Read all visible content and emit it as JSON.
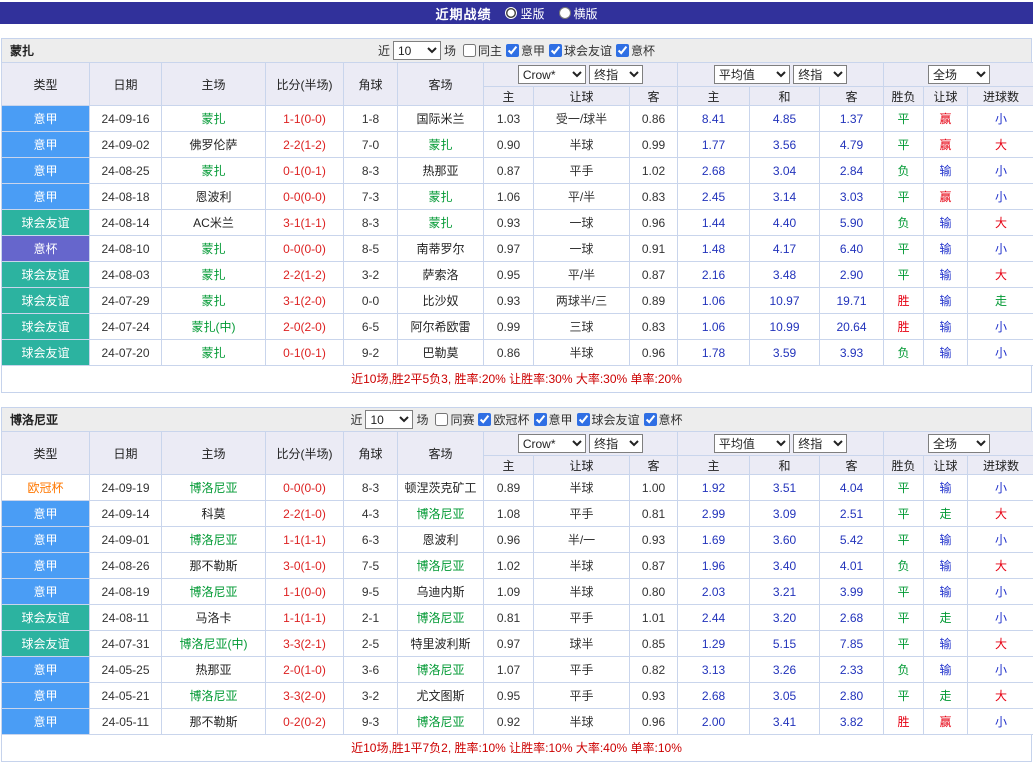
{
  "title_bar": {
    "title": "近期战绩",
    "layout_options": [
      {
        "label": "竖版",
        "selected": true
      },
      {
        "label": "横版",
        "selected": false
      }
    ]
  },
  "controls": {
    "recent_prefix": "近",
    "recent_count": "10",
    "recent_suffix": "场",
    "bookmaker": "Crow*",
    "final_index": "终指",
    "average": "平均值",
    "scope": "全场"
  },
  "columns": {
    "type": "类型",
    "date": "日期",
    "home": "主场",
    "score_half": "比分(半场)",
    "corner": "角球",
    "away": "客场",
    "odds_home": "主",
    "handicap": "让球",
    "odds_away": "客",
    "avg_home": "主",
    "avg_draw": "和",
    "avg_away": "客",
    "result": "胜负",
    "handicap_result": "让球",
    "goals": "进球数"
  },
  "colors": {
    "title_bar_bg": "#31319b",
    "serie_a_bg": "#4a9df5",
    "friendly_bg": "#2cb3a0",
    "italy_cup_bg": "#6666cc",
    "ucl_text": "#ff7700",
    "subject_team_green": "#009933",
    "score_red": "#dd2222",
    "win_red": "#e60012",
    "draw_green": "#009933",
    "lose_blue": "#2233cc",
    "avg_odds_blue": "#2233bb",
    "summary_red": "#cc0000"
  },
  "sections": [
    {
      "team": "蒙扎",
      "filters": [
        {
          "label": "同主",
          "checked": false
        },
        {
          "label": "意甲",
          "checked": true
        },
        {
          "label": "球会友谊",
          "checked": true
        },
        {
          "label": "意杯",
          "checked": true
        }
      ],
      "rows": [
        {
          "league": "意甲",
          "league_class": "lg-serie-a",
          "date": "24-09-16",
          "home": "蒙扎",
          "home_class": "subject",
          "score": "1-1(0-0)",
          "corner": "1-8",
          "away": "国际米兰",
          "away_class": "opponent",
          "odds_home": "1.03",
          "handicap": "受一/球半",
          "odds_away": "0.86",
          "avg_home": "8.41",
          "avg_draw": "4.85",
          "avg_away": "1.37",
          "result": "平",
          "result_class": "c-green",
          "handicap_result": "赢",
          "handicap_result_class": "c-red",
          "goals": "小",
          "goals_class": "c-blue"
        },
        {
          "league": "意甲",
          "league_class": "lg-serie-a",
          "date": "24-09-02",
          "home": "佛罗伦萨",
          "home_class": "opponent",
          "score": "2-2(1-2)",
          "corner": "7-0",
          "away": "蒙扎",
          "away_class": "subject",
          "odds_home": "0.90",
          "handicap": "半球",
          "odds_away": "0.99",
          "avg_home": "1.77",
          "avg_draw": "3.56",
          "avg_away": "4.79",
          "result": "平",
          "result_class": "c-green",
          "handicap_result": "赢",
          "handicap_result_class": "c-red",
          "goals": "大",
          "goals_class": "c-red"
        },
        {
          "league": "意甲",
          "league_class": "lg-serie-a",
          "date": "24-08-25",
          "home": "蒙扎",
          "home_class": "subject",
          "score": "0-1(0-1)",
          "corner": "8-3",
          "away": "热那亚",
          "away_class": "opponent",
          "odds_home": "0.87",
          "handicap": "平手",
          "odds_away": "1.02",
          "avg_home": "2.68",
          "avg_draw": "3.04",
          "avg_away": "2.84",
          "result": "负",
          "result_class": "c-green",
          "handicap_result": "输",
          "handicap_result_class": "c-blue",
          "goals": "小",
          "goals_class": "c-blue"
        },
        {
          "league": "意甲",
          "league_class": "lg-serie-a",
          "date": "24-08-18",
          "home": "恩波利",
          "home_class": "opponent",
          "score": "0-0(0-0)",
          "corner": "7-3",
          "away": "蒙扎",
          "away_class": "subject",
          "odds_home": "1.06",
          "handicap": "平/半",
          "odds_away": "0.83",
          "avg_home": "2.45",
          "avg_draw": "3.14",
          "avg_away": "3.03",
          "result": "平",
          "result_class": "c-green",
          "handicap_result": "赢",
          "handicap_result_class": "c-red",
          "goals": "小",
          "goals_class": "c-blue"
        },
        {
          "league": "球会友谊",
          "league_class": "lg-friendly",
          "date": "24-08-14",
          "home": "AC米兰",
          "home_class": "opponent",
          "score": "3-1(1-1)",
          "corner": "8-3",
          "away": "蒙扎",
          "away_class": "subject",
          "odds_home": "0.93",
          "handicap": "一球",
          "odds_away": "0.96",
          "avg_home": "1.44",
          "avg_draw": "4.40",
          "avg_away": "5.90",
          "result": "负",
          "result_class": "c-green",
          "handicap_result": "输",
          "handicap_result_class": "c-blue",
          "goals": "大",
          "goals_class": "c-red"
        },
        {
          "league": "意杯",
          "league_class": "lg-cup",
          "date": "24-08-10",
          "home": "蒙扎",
          "home_class": "subject",
          "score": "0-0(0-0)",
          "corner": "8-5",
          "away": "南蒂罗尔",
          "away_class": "opponent",
          "odds_home": "0.97",
          "handicap": "一球",
          "odds_away": "0.91",
          "avg_home": "1.48",
          "avg_draw": "4.17",
          "avg_away": "6.40",
          "result": "平",
          "result_class": "c-green",
          "handicap_result": "输",
          "handicap_result_class": "c-blue",
          "goals": "小",
          "goals_class": "c-blue"
        },
        {
          "league": "球会友谊",
          "league_class": "lg-friendly",
          "date": "24-08-03",
          "home": "蒙扎",
          "home_class": "subject",
          "score": "2-2(1-2)",
          "corner": "3-2",
          "away": "萨索洛",
          "away_class": "opponent",
          "odds_home": "0.95",
          "handicap": "平/半",
          "odds_away": "0.87",
          "avg_home": "2.16",
          "avg_draw": "3.48",
          "avg_away": "2.90",
          "result": "平",
          "result_class": "c-green",
          "handicap_result": "输",
          "handicap_result_class": "c-blue",
          "goals": "大",
          "goals_class": "c-red"
        },
        {
          "league": "球会友谊",
          "league_class": "lg-friendly",
          "date": "24-07-29",
          "home": "蒙扎",
          "home_class": "subject",
          "score": "3-1(2-0)",
          "corner": "0-0",
          "away": "比沙奴",
          "away_class": "opponent",
          "odds_home": "0.93",
          "handicap": "两球半/三",
          "odds_away": "0.89",
          "avg_home": "1.06",
          "avg_draw": "10.97",
          "avg_away": "19.71",
          "result": "胜",
          "result_class": "c-red",
          "handicap_result": "输",
          "handicap_result_class": "c-blue",
          "goals": "走",
          "goals_class": "c-green"
        },
        {
          "league": "球会友谊",
          "league_class": "lg-friendly",
          "date": "24-07-24",
          "home": "蒙扎(中)",
          "home_class": "subject",
          "score": "2-0(2-0)",
          "corner": "6-5",
          "away": "阿尔希欧雷",
          "away_class": "opponent",
          "odds_home": "0.99",
          "handicap": "三球",
          "odds_away": "0.83",
          "avg_home": "1.06",
          "avg_draw": "10.99",
          "avg_away": "20.64",
          "result": "胜",
          "result_class": "c-red",
          "handicap_result": "输",
          "handicap_result_class": "c-blue",
          "goals": "小",
          "goals_class": "c-blue"
        },
        {
          "league": "球会友谊",
          "league_class": "lg-friendly",
          "date": "24-07-20",
          "home": "蒙扎",
          "home_class": "subject",
          "score": "0-1(0-1)",
          "corner": "9-2",
          "away": "巴勒莫",
          "away_class": "opponent",
          "odds_home": "0.86",
          "handicap": "半球",
          "odds_away": "0.96",
          "avg_home": "1.78",
          "avg_draw": "3.59",
          "avg_away": "3.93",
          "result": "负",
          "result_class": "c-green",
          "handicap_result": "输",
          "handicap_result_class": "c-blue",
          "goals": "小",
          "goals_class": "c-blue"
        }
      ],
      "summary": "近10场,胜2平5负3, 胜率:20% 让胜率:30% 大率:30% 单率:20%"
    },
    {
      "team": "博洛尼亚",
      "filters": [
        {
          "label": "同赛",
          "checked": false
        },
        {
          "label": "欧冠杯",
          "checked": true
        },
        {
          "label": "意甲",
          "checked": true
        },
        {
          "label": "球会友谊",
          "checked": true
        },
        {
          "label": "意杯",
          "checked": true
        }
      ],
      "rows": [
        {
          "league": "欧冠杯",
          "league_class": "lg-ucl",
          "date": "24-09-19",
          "home": "博洛尼亚",
          "home_class": "subject",
          "score": "0-0(0-0)",
          "corner": "8-3",
          "away": "顿涅茨克矿工",
          "away_class": "opponent",
          "odds_home": "0.89",
          "handicap": "半球",
          "odds_away": "1.00",
          "avg_home": "1.92",
          "avg_draw": "3.51",
          "avg_away": "4.04",
          "result": "平",
          "result_class": "c-green",
          "handicap_result": "输",
          "handicap_result_class": "c-blue",
          "goals": "小",
          "goals_class": "c-blue"
        },
        {
          "league": "意甲",
          "league_class": "lg-serie-a",
          "date": "24-09-14",
          "home": "科莫",
          "home_class": "opponent",
          "score": "2-2(1-0)",
          "corner": "4-3",
          "away": "博洛尼亚",
          "away_class": "subject",
          "odds_home": "1.08",
          "handicap": "平手",
          "odds_away": "0.81",
          "avg_home": "2.99",
          "avg_draw": "3.09",
          "avg_away": "2.51",
          "result": "平",
          "result_class": "c-green",
          "handicap_result": "走",
          "handicap_result_class": "c-green",
          "goals": "大",
          "goals_class": "c-red"
        },
        {
          "league": "意甲",
          "league_class": "lg-serie-a",
          "date": "24-09-01",
          "home": "博洛尼亚",
          "home_class": "subject",
          "score": "1-1(1-1)",
          "corner": "6-3",
          "away": "恩波利",
          "away_class": "opponent",
          "odds_home": "0.96",
          "handicap": "半/一",
          "odds_away": "0.93",
          "avg_home": "1.69",
          "avg_draw": "3.60",
          "avg_away": "5.42",
          "result": "平",
          "result_class": "c-green",
          "handicap_result": "输",
          "handicap_result_class": "c-blue",
          "goals": "小",
          "goals_class": "c-blue"
        },
        {
          "league": "意甲",
          "league_class": "lg-serie-a",
          "date": "24-08-26",
          "home": "那不勒斯",
          "home_class": "opponent",
          "score": "3-0(1-0)",
          "corner": "7-5",
          "away": "博洛尼亚",
          "away_class": "subject",
          "odds_home": "1.02",
          "handicap": "半球",
          "odds_away": "0.87",
          "avg_home": "1.96",
          "avg_draw": "3.40",
          "avg_away": "4.01",
          "result": "负",
          "result_class": "c-green",
          "handicap_result": "输",
          "handicap_result_class": "c-blue",
          "goals": "大",
          "goals_class": "c-red"
        },
        {
          "league": "意甲",
          "league_class": "lg-serie-a",
          "date": "24-08-19",
          "home": "博洛尼亚",
          "home_class": "subject",
          "score": "1-1(0-0)",
          "corner": "9-5",
          "away": "乌迪内斯",
          "away_class": "opponent",
          "odds_home": "1.09",
          "handicap": "半球",
          "odds_away": "0.80",
          "avg_home": "2.03",
          "avg_draw": "3.21",
          "avg_away": "3.99",
          "result": "平",
          "result_class": "c-green",
          "handicap_result": "输",
          "handicap_result_class": "c-blue",
          "goals": "小",
          "goals_class": "c-blue"
        },
        {
          "league": "球会友谊",
          "league_class": "lg-friendly",
          "date": "24-08-11",
          "home": "马洛卡",
          "home_class": "opponent",
          "score": "1-1(1-1)",
          "corner": "2-1",
          "away": "博洛尼亚",
          "away_class": "subject",
          "odds_home": "0.81",
          "handicap": "平手",
          "odds_away": "1.01",
          "avg_home": "2.44",
          "avg_draw": "3.20",
          "avg_away": "2.68",
          "result": "平",
          "result_class": "c-green",
          "handicap_result": "走",
          "handicap_result_class": "c-green",
          "goals": "小",
          "goals_class": "c-blue"
        },
        {
          "league": "球会友谊",
          "league_class": "lg-friendly",
          "date": "24-07-31",
          "home": "博洛尼亚(中)",
          "home_class": "subject",
          "score": "3-3(2-1)",
          "corner": "2-5",
          "away": "特里波利斯",
          "away_class": "opponent",
          "odds_home": "0.97",
          "handicap": "球半",
          "odds_away": "0.85",
          "avg_home": "1.29",
          "avg_draw": "5.15",
          "avg_away": "7.85",
          "result": "平",
          "result_class": "c-green",
          "handicap_result": "输",
          "handicap_result_class": "c-blue",
          "goals": "大",
          "goals_class": "c-red"
        },
        {
          "league": "意甲",
          "league_class": "lg-serie-a",
          "date": "24-05-25",
          "home": "热那亚",
          "home_class": "opponent",
          "score": "2-0(1-0)",
          "corner": "3-6",
          "away": "博洛尼亚",
          "away_class": "subject",
          "odds_home": "1.07",
          "handicap": "平手",
          "odds_away": "0.82",
          "avg_home": "3.13",
          "avg_draw": "3.26",
          "avg_away": "2.33",
          "result": "负",
          "result_class": "c-green",
          "handicap_result": "输",
          "handicap_result_class": "c-blue",
          "goals": "小",
          "goals_class": "c-blue"
        },
        {
          "league": "意甲",
          "league_class": "lg-serie-a",
          "date": "24-05-21",
          "home": "博洛尼亚",
          "home_class": "subject",
          "score": "3-3(2-0)",
          "corner": "3-2",
          "away": "尤文图斯",
          "away_class": "opponent",
          "odds_home": "0.95",
          "handicap": "平手",
          "odds_away": "0.93",
          "avg_home": "2.68",
          "avg_draw": "3.05",
          "avg_away": "2.80",
          "result": "平",
          "result_class": "c-green",
          "handicap_result": "走",
          "handicap_result_class": "c-green",
          "goals": "大",
          "goals_class": "c-red"
        },
        {
          "league": "意甲",
          "league_class": "lg-serie-a",
          "date": "24-05-11",
          "home": "那不勒斯",
          "home_class": "opponent",
          "score": "0-2(0-2)",
          "corner": "9-3",
          "away": "博洛尼亚",
          "away_class": "subject",
          "odds_home": "0.92",
          "handicap": "半球",
          "odds_away": "0.96",
          "avg_home": "2.00",
          "avg_draw": "3.41",
          "avg_away": "3.82",
          "result": "胜",
          "result_class": "c-red",
          "handicap_result": "赢",
          "handicap_result_class": "c-red",
          "goals": "小",
          "goals_class": "c-blue"
        }
      ],
      "summary": "近10场,胜1平7负2, 胜率:10% 让胜率:10% 大率:40% 单率:10%"
    }
  ]
}
